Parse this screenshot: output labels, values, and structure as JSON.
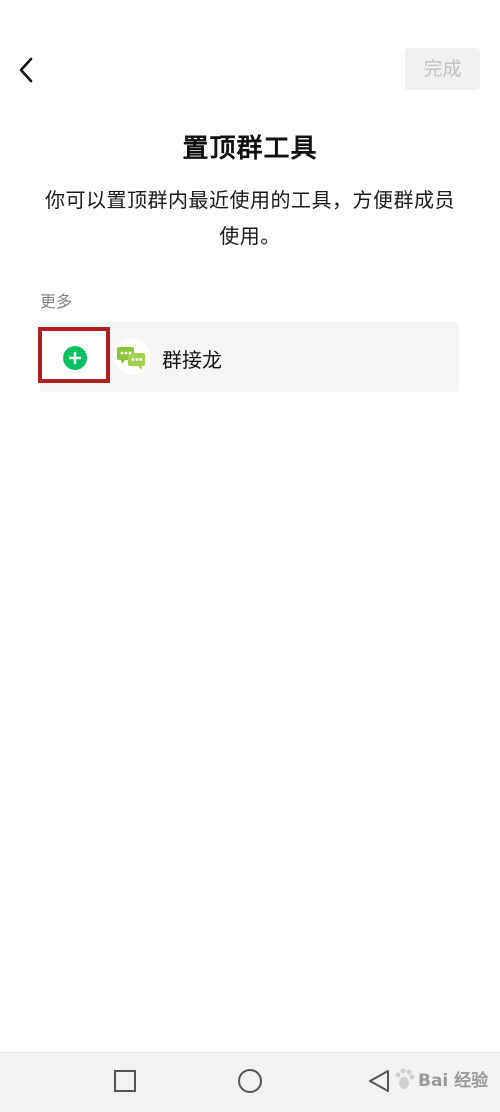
{
  "header": {
    "back_icon": "chevron-left-icon",
    "done_label": "完成"
  },
  "main": {
    "title": "置顶群工具",
    "description": "你可以置顶群内最近使用的工具，方便群成员使用。",
    "section_label": "更多",
    "tools": [
      {
        "name": "群接龙",
        "add_icon": "plus-circle-icon",
        "icon": "group-solitaire-icon"
      }
    ]
  },
  "nav": {
    "recent_icon": "square-icon",
    "home_icon": "circle-icon",
    "back_icon": "triangle-back-icon"
  },
  "watermark": {
    "text": "Bai 经验"
  },
  "colors": {
    "accent_green": "#07c160",
    "highlight_red": "#b21f1f",
    "done_bg": "#f0f0f0",
    "done_text": "#c2c2c2",
    "tool_icon_green": "#8cc63f"
  }
}
